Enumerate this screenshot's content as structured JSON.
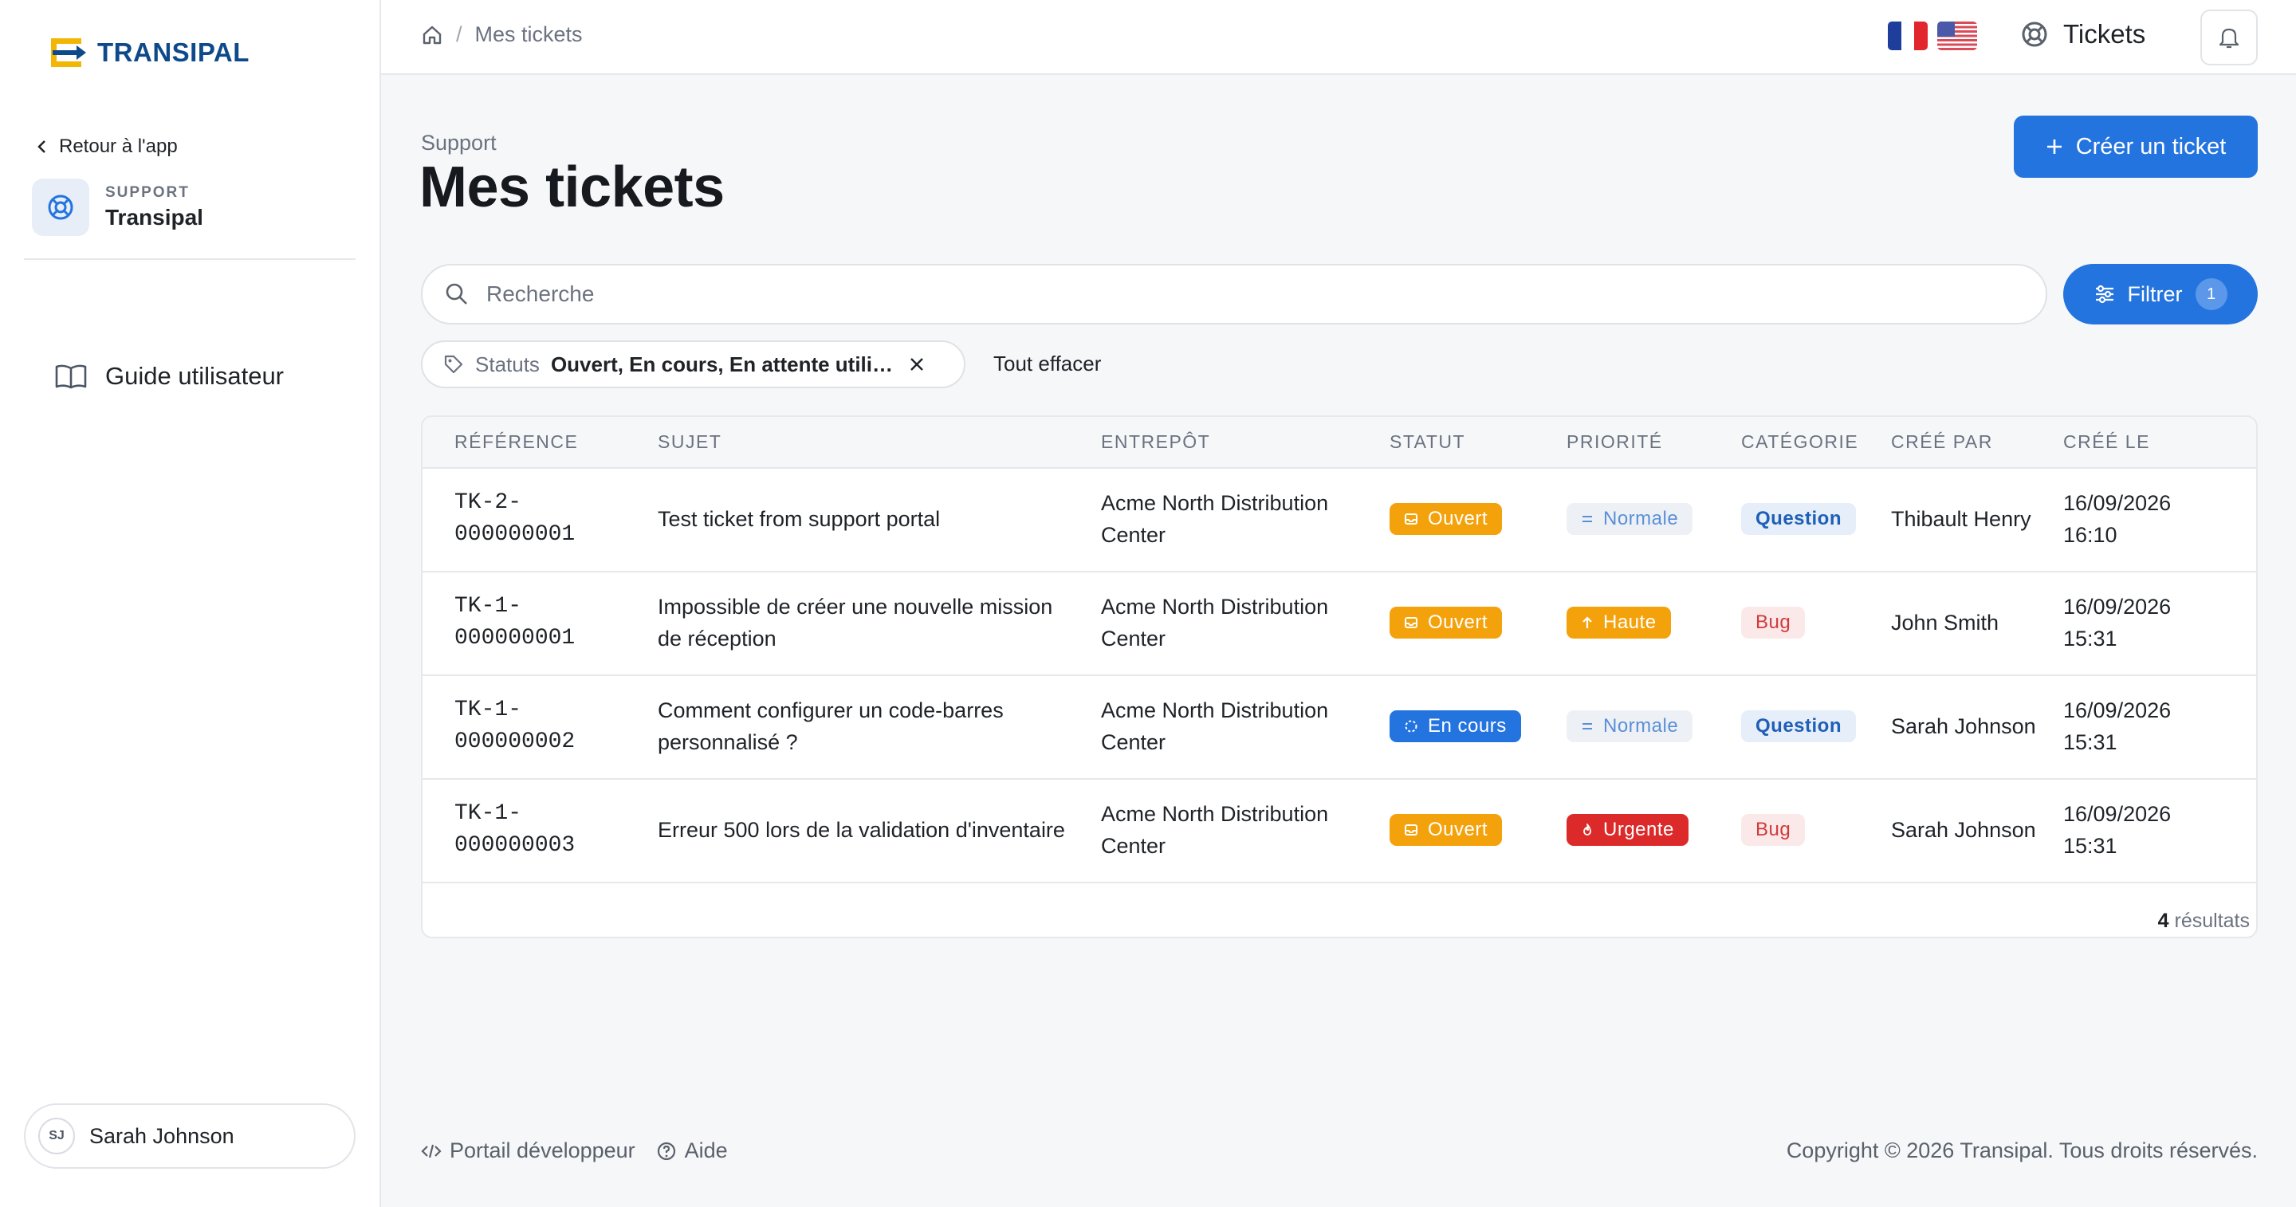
{
  "brand": {
    "name": "TRANSIPAL",
    "accent": "#2474e0",
    "yellow": "#f2b705",
    "navy": "#0e4a8a"
  },
  "sidebar": {
    "back_label": "Retour à l'app",
    "support_kicker": "SUPPORT",
    "support_name": "Transipal",
    "nav": [
      {
        "label": "Guide utilisateur",
        "icon": "book-icon"
      }
    ],
    "user": {
      "initials": "SJ",
      "name": "Sarah Johnson"
    }
  },
  "topbar": {
    "breadcrumb": {
      "home_icon": "home-icon",
      "current": "Mes tickets"
    },
    "languages": [
      "fr",
      "en-us"
    ],
    "tickets_label": "Tickets"
  },
  "header": {
    "kicker": "Support",
    "title": "Mes tickets",
    "create_label": "Créer un ticket"
  },
  "search": {
    "placeholder": "Recherche",
    "value": ""
  },
  "filter": {
    "label": "Filtrer",
    "count": "1"
  },
  "active_filter": {
    "key": "Statuts",
    "value": "Ouvert, En cours, En attente utilisateur",
    "clear_all": "Tout effacer"
  },
  "table": {
    "columns": [
      "RÉFÉRENCE",
      "SUJET",
      "ENTREPÔT",
      "STATUT",
      "PRIORITÉ",
      "CATÉGORIE",
      "CRÉÉ PAR",
      "CRÉÉ LE"
    ],
    "rows": [
      {
        "ref_a": "TK-2-",
        "ref_b": "000000001",
        "subject": "Test ticket from support portal",
        "warehouse": "Acme North Distribution Center",
        "status": "Ouvert",
        "status_kind": "open",
        "priority": "Normale",
        "priority_kind": "normal",
        "category": "Question",
        "category_kind": "question",
        "created_by": "Thibault Henry",
        "date": "16/09/2026",
        "time": "16:10"
      },
      {
        "ref_a": "TK-1-",
        "ref_b": "000000001",
        "subject": "Impossible de créer une nouvelle mission de réception",
        "warehouse": "Acme North Distribution Center",
        "status": "Ouvert",
        "status_kind": "open",
        "priority": "Haute",
        "priority_kind": "high",
        "category": "Bug",
        "category_kind": "bug",
        "created_by": "John Smith",
        "date": "16/09/2026",
        "time": "15:31"
      },
      {
        "ref_a": "TK-1-",
        "ref_b": "000000002",
        "subject": "Comment configurer un code-barres personnalisé ?",
        "warehouse": "Acme North Distribution Center",
        "status": "En cours",
        "status_kind": "progress",
        "priority": "Normale",
        "priority_kind": "normal",
        "category": "Question",
        "category_kind": "question",
        "created_by": "Sarah Johnson",
        "date": "16/09/2026",
        "time": "15:31"
      },
      {
        "ref_a": "TK-1-",
        "ref_b": "000000003",
        "subject": "Erreur 500 lors de la validation d'inventaire",
        "warehouse": "Acme North Distribution Center",
        "status": "Ouvert",
        "status_kind": "open",
        "priority": "Urgente",
        "priority_kind": "urgent",
        "category": "Bug",
        "category_kind": "bug",
        "created_by": "Sarah Johnson",
        "date": "16/09/2026",
        "time": "15:31"
      }
    ],
    "results_count": "4",
    "results_label": "résultats"
  },
  "footer": {
    "dev_portal": "Portail développeur",
    "help": "Aide",
    "copyright": "Copyright © 2026 Transipal. Tous droits réservés."
  }
}
